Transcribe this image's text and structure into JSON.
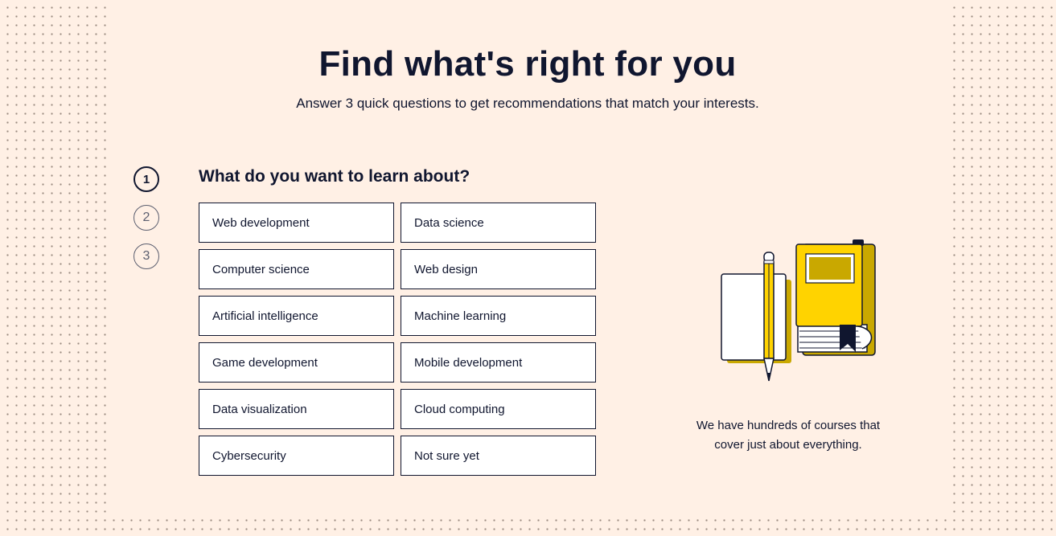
{
  "header": {
    "title": "Find what's right for you",
    "subtitle": "Answer 3 quick questions to get recommendations that match your interests."
  },
  "stepper": {
    "steps": [
      "1",
      "2",
      "3"
    ],
    "active_step": 1
  },
  "question": {
    "text": "What do you want to learn about?",
    "options": [
      "Web development",
      "Data science",
      "Computer science",
      "Web design",
      "Artificial intelligence",
      "Machine learning",
      "Game development",
      "Mobile development",
      "Data visualization",
      "Cloud computing",
      "Cybersecurity",
      "Not sure yet"
    ]
  },
  "aside": {
    "text": "We have hundreds of courses that cover just about everything.",
    "illustration_icon": "notebook-pencil-book-icon"
  },
  "colors": {
    "background": "#fff0e5",
    "text": "#10162f",
    "accent_yellow": "#ffd300",
    "accent_dark_yellow": "#c9a800"
  }
}
